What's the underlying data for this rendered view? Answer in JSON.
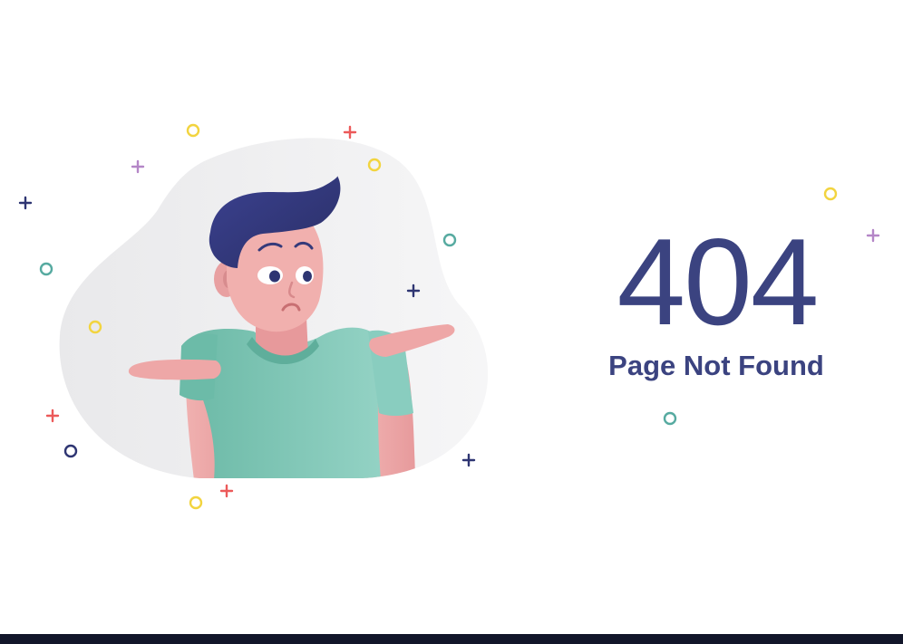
{
  "error": {
    "code": "404",
    "message": "Page Not Found"
  },
  "colors": {
    "heading": "#3b4380",
    "background": "#ffffff",
    "blob": "#ececee",
    "hair": "#353a7a",
    "skin": "#eda5a5",
    "shirt": "#7cc5b4",
    "plus_red": "#ec5a5a",
    "plus_purple": "#b486c7",
    "plus_navy": "#2e3572",
    "ring_yellow": "#f2d43f",
    "ring_teal": "#56aaa0",
    "ring_navy": "#2e3572",
    "bottom_bar": "#12162a"
  },
  "illustration": {
    "subject": "person shrugging with open palms",
    "decorations": [
      "plus-signs",
      "small-rings"
    ]
  }
}
